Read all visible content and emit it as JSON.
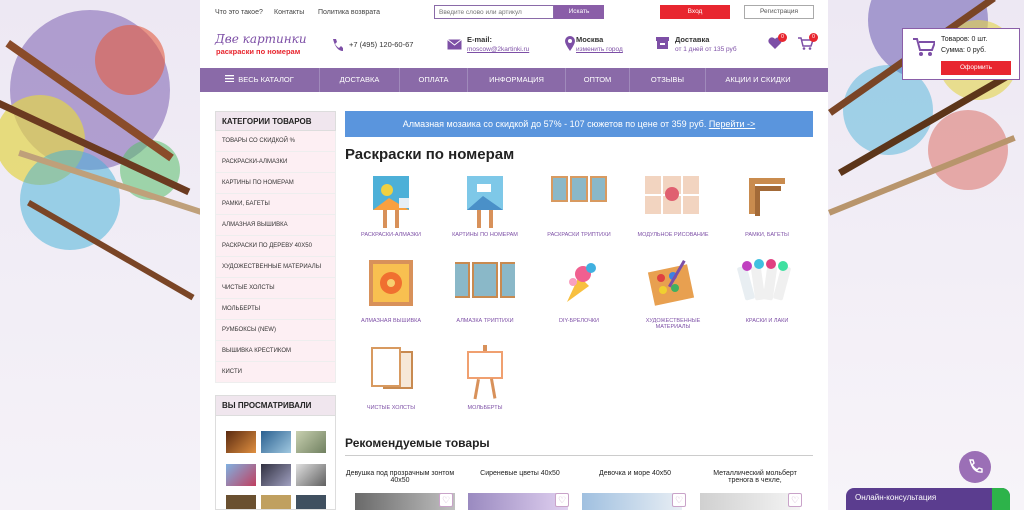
{
  "top": {
    "links": [
      "Что это такое?",
      "Контакты",
      "Политика возврата"
    ],
    "search_placeholder": "Введите слово или артикул",
    "search_button": "Искать",
    "login": "Вход",
    "register": "Регистрация"
  },
  "header": {
    "logo_title": "Две картинки",
    "logo_sub": "раскраски  по номерам",
    "phone": "+7 (495) 120-60-67",
    "email_label": "E-mail:",
    "email": "moscow@2kartinki.ru",
    "city": "Москва",
    "city_change": "изменить город",
    "delivery_label": "Доставка",
    "delivery_info": "от 1 дней от 135 руб",
    "favorites_count": "0",
    "cart_count": "0"
  },
  "cart": {
    "items": "Товаров: 0 шт.",
    "sum": "Сумма: 0 руб.",
    "checkout": "Оформить"
  },
  "nav": [
    "ВЕСЬ КАТАЛОГ",
    "ДОСТАВКА",
    "ОПЛАТА",
    "ИНФОРМАЦИЯ",
    "ОПТОМ",
    "ОТЗЫВЫ",
    "АКЦИИ И СКИДКИ"
  ],
  "sidebar": {
    "title": "КАТЕГОРИИ ТОВАРОВ",
    "items": [
      "ТОВАРЫ СО СКИДКОЙ %",
      "РАСКРАСКИ-АЛМАЗКИ",
      "КАРТИНЫ ПО НОМЕРАМ",
      "РАМКИ, БАГЕТЫ",
      "АЛМАЗНАЯ ВЫШИВКА",
      "РАСКРАСКИ ПО ДЕРЕВУ 40Х50",
      "ХУДОЖЕСТВЕННЫЕ МАТЕРИАЛЫ",
      "ЧИСТЫЕ ХОЛСТЫ",
      "МОЛЬБЕРТЫ",
      "РУМБОКСЫ (NEW)",
      "ВЫШИВКА КРЕСТИКОМ",
      "КИСТИ"
    ],
    "viewed_title": "ВЫ ПРОСМАТРИВАЛИ"
  },
  "banner": {
    "text": "Алмазная мозаика со скидкой до 57% - 107 сюжетов по цене от 359 руб.",
    "link": "Перейти ->"
  },
  "main": {
    "title": "Раскраски по номерам",
    "categories": [
      "РАСКРАСКИ-АЛМАЗКИ",
      "КАРТИНЫ ПО НОМЕРАМ",
      "РАСКРАСКИ ТРИПТИХИ",
      "МОДУЛЬНОЕ РИСОВАНИЕ",
      "РАМКИ, БАГЕТЫ",
      "АЛМАЗНАЯ ВЫШИВКА",
      "АЛМАЗКА ТРИПТИХИ",
      "DIY-БРЕЛОЧКИ",
      "ХУДОЖЕСТВЕННЫЕ МАТЕРИАЛЫ",
      "КРАСКИ И ЛАКИ",
      "ЧИСТЫЕ ХОЛСТЫ",
      "МОЛЬБЕРТЫ"
    ],
    "recommended_title": "Рекомендуемые товары",
    "products": [
      "Девушка под прозрачным зонтом 40х50",
      "Сиреневые цветы 40х50",
      "Девочка и море 40х50",
      "Металлический мольберт тренога в чехле,"
    ]
  },
  "widget": {
    "consult": "Онлайн-консультация"
  }
}
